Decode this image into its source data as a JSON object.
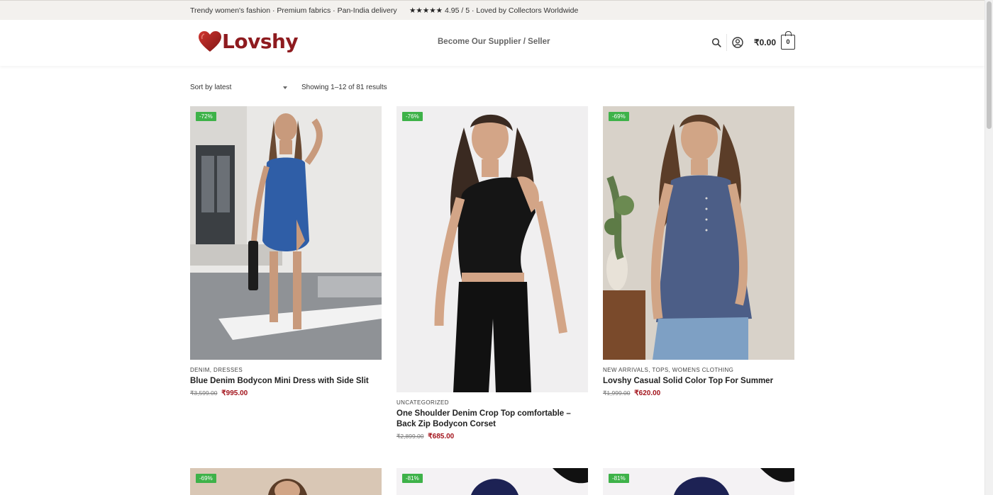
{
  "topbar": {
    "left_text": "Trendy women's fashion · Premium fabrics · Pan-India delivery",
    "rating_stars": "★★★★★",
    "rating_text": "4.95 / 5 · Loved by Collectors Worldwide"
  },
  "header": {
    "brand": "Lovshy",
    "nav_link": "Become Our Supplier / Seller",
    "cart_total": "₹0.00",
    "cart_count": "0"
  },
  "toolbar": {
    "sort_label": "Sort by latest",
    "results_text": "Showing 1–12 of 81 results"
  },
  "products": [
    {
      "badge": "-72%",
      "categories": "DENIM, DRESSES",
      "title": "Blue Denim Bodycon Mini Dress with Side Slit",
      "old_price": "₹3,599.00",
      "new_price": "₹995.00"
    },
    {
      "badge": "-76%",
      "categories": "UNCATEGORIZED",
      "title": "One Shoulder Denim Crop Top comfortable – Back Zip Bodycon Corset",
      "old_price": "₹2,899.00",
      "new_price": "₹685.00"
    },
    {
      "badge": "-69%",
      "categories": "NEW ARRIVALS, TOPS, WOMENS CLOTHING",
      "title": "Lovshy Casual Solid Color Top For Summer",
      "old_price": "₹1,999.00",
      "new_price": "₹620.00"
    },
    {
      "badge": "-69%"
    },
    {
      "badge": "-81%"
    },
    {
      "badge": "-81%"
    }
  ],
  "colors": {
    "brand": "#8e1b1f",
    "badge": "#3eb249",
    "sale_price": "#a3141c",
    "topbar_bg": "#f3f1ee"
  }
}
